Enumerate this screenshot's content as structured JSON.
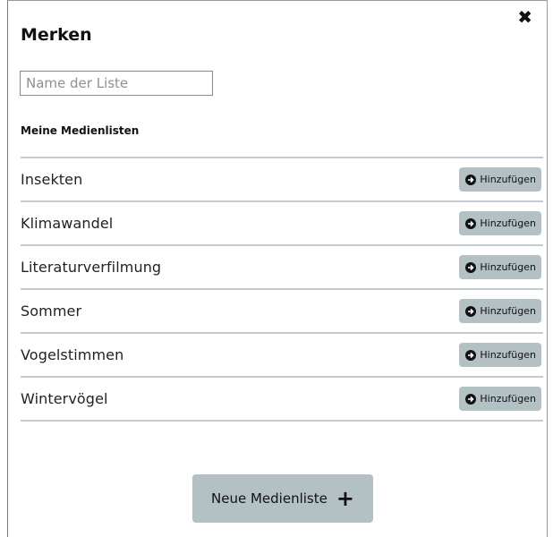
{
  "dialog": {
    "title": "Merken",
    "close_icon": "close-icon"
  },
  "name_input": {
    "placeholder": "Name der Liste",
    "value": ""
  },
  "section_heading": "Meine Medienlisten",
  "lists": [
    {
      "label": "Insekten",
      "button": "Hinzufügen"
    },
    {
      "label": "Klimawandel",
      "button": "Hinzufügen"
    },
    {
      "label": "Literaturverfilmung",
      "button": "Hinzufügen"
    },
    {
      "label": "Sommer",
      "button": "Hinzufügen"
    },
    {
      "label": "Vogelstimmen",
      "button": "Hinzufügen"
    },
    {
      "label": "Wintervögel",
      "button": "Hinzufügen"
    }
  ],
  "new_list_button": {
    "label": "Neue Medienliste",
    "icon": "plus-icon"
  },
  "colors": {
    "button_bg": "#b3c1c5",
    "divider": "#c5ccd1"
  }
}
